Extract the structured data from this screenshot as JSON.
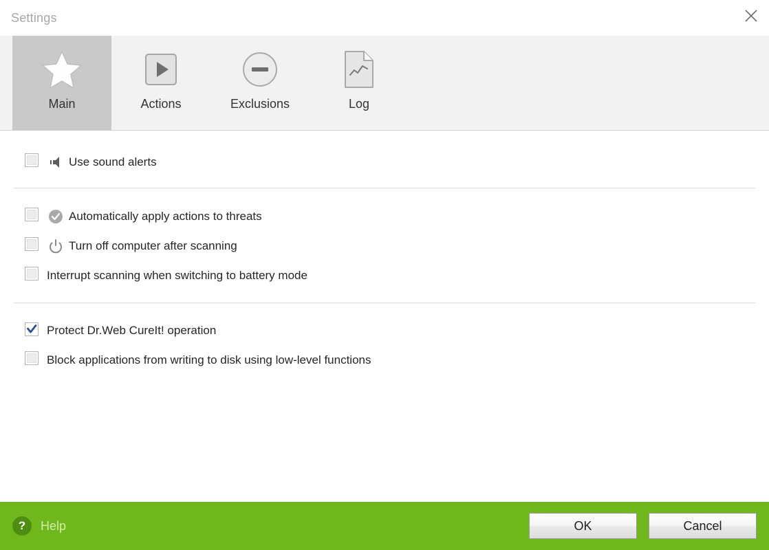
{
  "window": {
    "title": "Settings",
    "close_icon": "close-icon"
  },
  "tabs": [
    {
      "label": "Main",
      "icon": "star-icon",
      "selected": true
    },
    {
      "label": "Actions",
      "icon": "play-square-icon",
      "selected": false
    },
    {
      "label": "Exclusions",
      "icon": "minus-circle-icon",
      "selected": false
    },
    {
      "label": "Log",
      "icon": "document-chart-icon",
      "selected": false
    }
  ],
  "groups": [
    {
      "rows": [
        {
          "label": "Use sound alerts",
          "checked": false,
          "icon": "speaker-icon"
        }
      ]
    },
    {
      "rows": [
        {
          "label": "Automatically apply actions to threats",
          "checked": false,
          "icon": "check-circle-icon"
        },
        {
          "label": "Turn off computer after scanning",
          "checked": false,
          "icon": "power-icon"
        },
        {
          "label": "Interrupt scanning when switching to battery mode",
          "checked": false,
          "icon": "none"
        }
      ]
    },
    {
      "rows": [
        {
          "label": "Protect Dr.Web CureIt! operation",
          "checked": true,
          "icon": "none"
        },
        {
          "label": "Block applications from writing to disk using low-level functions",
          "checked": false,
          "icon": "none"
        }
      ]
    }
  ],
  "footer": {
    "help_label": "Help",
    "help_icon_glyph": "?",
    "ok_label": "OK",
    "cancel_label": "Cancel"
  },
  "colors": {
    "footer_green": "#6fb71c",
    "help_circle_green": "#4e8d12",
    "help_text_green": "#d5efa8",
    "selected_tab_gray": "#c9c9c9",
    "tabstrip_gray": "#f2f2f2",
    "checked_check_blue": "#2b4f90",
    "separator_gray": "#dcdcdc",
    "title_gray": "#a8a8a8"
  }
}
